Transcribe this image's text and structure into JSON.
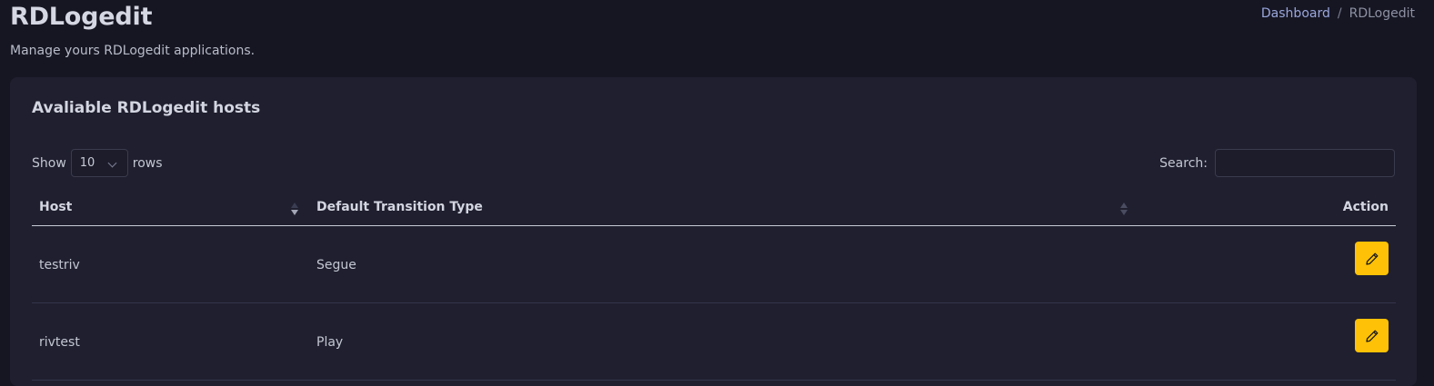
{
  "header": {
    "title": "RDLogedit",
    "subtitle": "Manage yours RDLogedit applications."
  },
  "breadcrumb": {
    "link": "Dashboard",
    "separator": "/",
    "current": "RDLogedit"
  },
  "card": {
    "title": "Avaliable RDLogedit hosts",
    "length": {
      "prefix": "Show",
      "value": "10",
      "suffix": "rows"
    },
    "search": {
      "label": "Search:",
      "value": "",
      "placeholder": ""
    },
    "columns": {
      "host": "Host",
      "type": "Default Transition Type",
      "action": "Action"
    },
    "rows": [
      {
        "host": "testriv",
        "type": "Segue"
      },
      {
        "host": "rivtest",
        "type": "Play"
      }
    ]
  },
  "colors": {
    "background": "#161623",
    "card": "#1f1f2f",
    "edit_button": "#ffc107",
    "link": "#9aa7dc"
  },
  "icons": {
    "sort": "sort-icon",
    "edit": "pencil-icon",
    "dropdown": "chevron-down-icon"
  }
}
